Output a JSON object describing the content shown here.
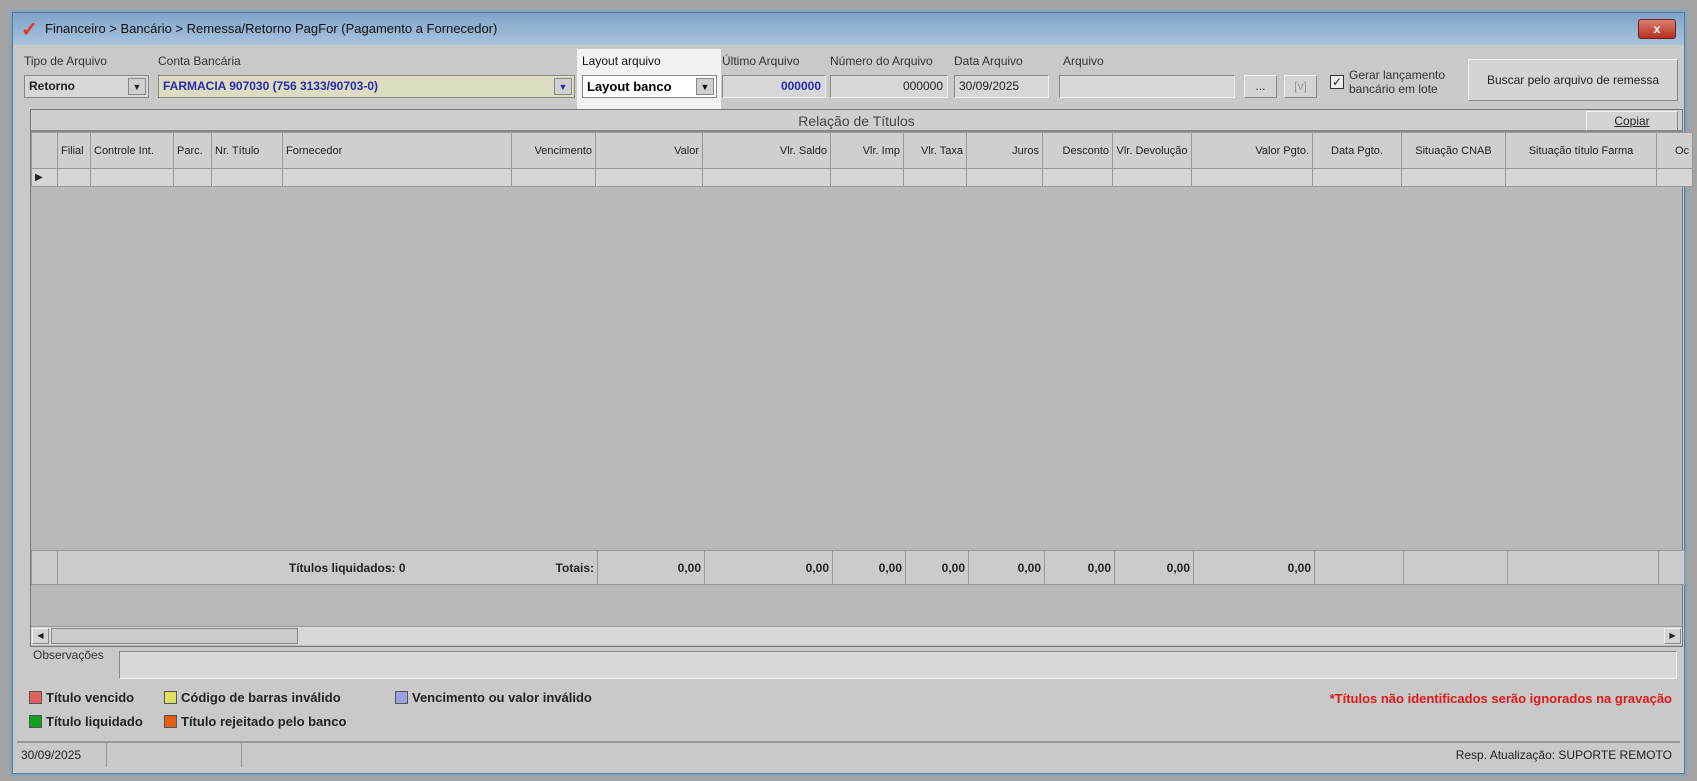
{
  "window": {
    "title": "Financeiro > Bancário > Remessa/Retorno PagFor (Pagamento  a Fornecedor)",
    "close": "x"
  },
  "form": {
    "tipo_label": "Tipo de Arquivo",
    "tipo_value": "Retorno",
    "conta_label": "Conta Bancária",
    "conta_value": "FARMACIA 907030 (756 3133/90703-0)",
    "layout_label": "Layout arquivo",
    "layout_value": "Layout banco",
    "ultimo_label": "Último Arquivo",
    "ultimo_value": "000000",
    "numero_label": "Número do Arquivo",
    "numero_value": "000000",
    "data_label": "Data Arquivo",
    "data_value": "30/09/2025",
    "arquivo_label": "Arquivo",
    "arquivo_value": "",
    "browse_label": "...",
    "view_label": "[v]",
    "gerar_label_1": "Gerar lançamento",
    "gerar_label_2": "bancário em lote",
    "gerar_checked": true,
    "buscar_label": "Buscar pelo arquivo de remessa"
  },
  "grid": {
    "title": "Relação de Títulos",
    "copy_label": "Copiar",
    "columns": [
      "",
      "Filial",
      "Controle Int.",
      "Parc.",
      "Nr. Título",
      "Fornecedor",
      "Vencimento",
      "Valor",
      "Vlr. Saldo",
      "Vlr. Imp",
      "Vlr. Taxa",
      "Juros",
      "Desconto",
      "Vlr. Devolução",
      "Valor Pgto.",
      "Data Pgto.",
      "Situação CNAB",
      "Situação título Farma",
      "Oc"
    ],
    "liquidados": "Títulos liquidados: 0",
    "totais_label": "Totais:",
    "totals": [
      "0,00",
      "0,00",
      "0,00",
      "0,00",
      "0,00",
      "0,00",
      "0,00",
      "0,00"
    ]
  },
  "obs": {
    "label": "Observações",
    "value": ""
  },
  "legend": [
    {
      "label": "Título vencido",
      "color": "#e06060"
    },
    {
      "label": "Código de barras inválido",
      "color": "#e0e060"
    },
    {
      "label": "Vencimento ou valor inválido",
      "color": "#a0a0e0"
    },
    {
      "label": "Título liquidado",
      "color": "#10a020"
    },
    {
      "label": "Título rejeitado pelo banco",
      "color": "#e06010"
    }
  ],
  "warning": "*Títulos não identificados serão ignorados na gravação",
  "status": {
    "date": "30/09/2025",
    "resp": "Resp. Atualização: SUPORTE REMOTO"
  }
}
